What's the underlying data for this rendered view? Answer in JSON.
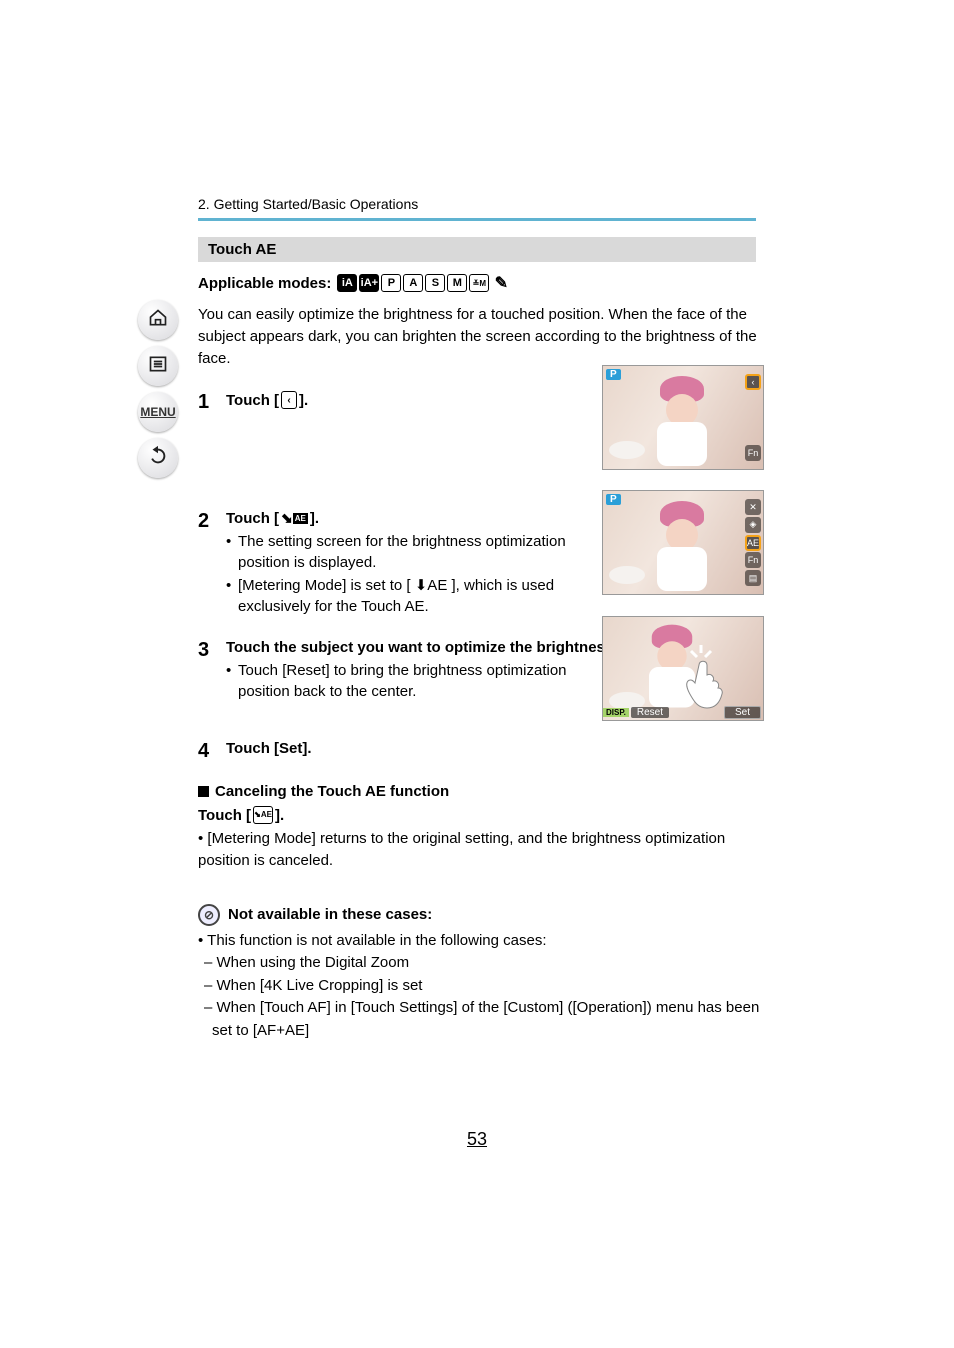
{
  "breadcrumb": "2. Getting Started/Basic Operations",
  "section_title": "Touch AE",
  "applicable_label": "Applicable modes:",
  "modes": {
    "ia": "iA",
    "iap": "iA+",
    "p": "P",
    "a": "A",
    "s": "S",
    "m": "M",
    "mov": "≚M",
    "c": "✎"
  },
  "intro": "You can easily optimize the brightness for a touched position. When the face of the subject appears dark, you can brighten the screen according to the brightness of the face.",
  "steps": [
    {
      "num": "1",
      "title_pre": "Touch [",
      "title_post": "]."
    },
    {
      "num": "2",
      "title_pre": "Touch [ ",
      "title_post": " ].",
      "bullets": [
        "The setting screen for the brightness optimization position is displayed.",
        "[Metering Mode] is set to [ ⬇AE ], which is used exclusively for the Touch AE."
      ]
    },
    {
      "num": "3",
      "title": "Touch the subject you want to optimize the brightness for.",
      "bullets": [
        "Touch [Reset] to bring the brightness optimization position back to the center."
      ]
    },
    {
      "num": "4",
      "title": "Touch [Set]."
    }
  ],
  "cancel_hdr": "Canceling the Touch AE function",
  "cancel_line_pre": "Touch [",
  "cancel_line_post": "].",
  "after_cancel": "[Metering Mode] returns to the original setting, and the brightness optimization position is canceled.",
  "note_hdr": "Not available in these cases:",
  "note_lines": {
    "lead": "This function is not available in the following cases:",
    "a": "When using the Digital Zoom",
    "b": "When [4K Live Cropping] is set",
    "c": "When [Touch AF] in [Touch Settings] of the [Custom] ([Operation]) menu has been set to [AF+AE]"
  },
  "page_num": "53",
  "nav": {
    "menu": "MENU"
  },
  "shot": {
    "p": "P",
    "fn": "Fn",
    "disp": "DISP.",
    "reset": "Reset",
    "set": "Set",
    "tab": "‹"
  }
}
